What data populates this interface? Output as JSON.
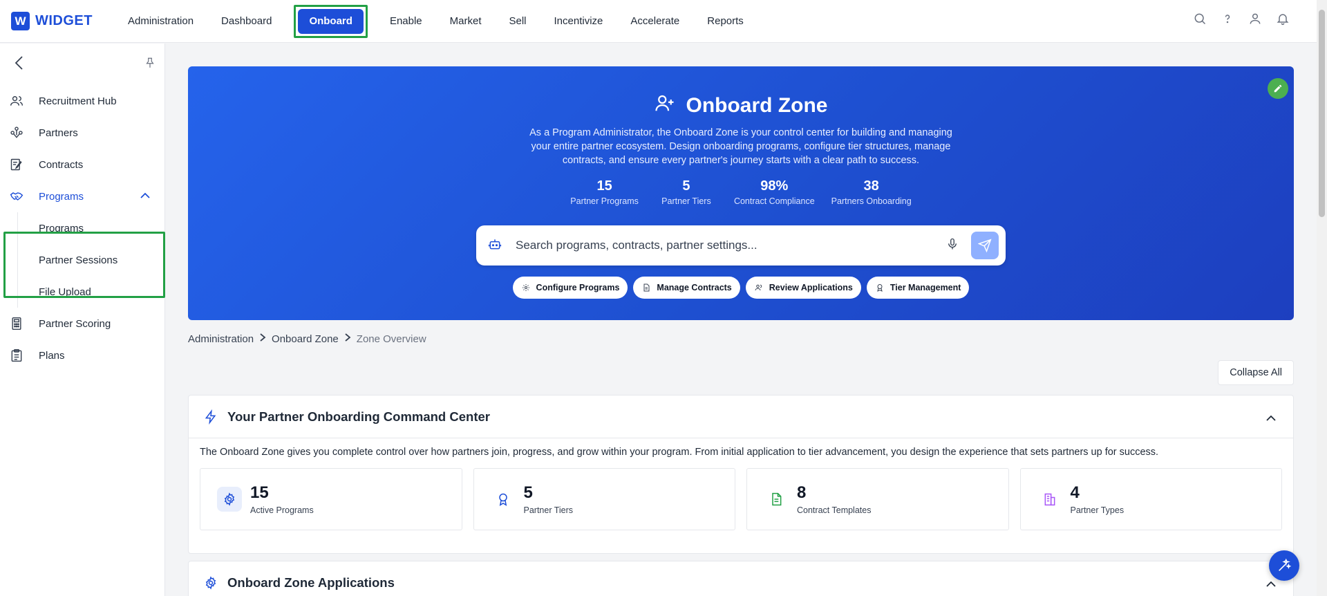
{
  "logo": {
    "mark": "W",
    "text": "WIDGET"
  },
  "nav": {
    "items": [
      {
        "label": "Administration"
      },
      {
        "label": "Dashboard"
      },
      {
        "label": "Onboard"
      },
      {
        "label": "Enable"
      },
      {
        "label": "Market"
      },
      {
        "label": "Sell"
      },
      {
        "label": "Incentivize"
      },
      {
        "label": "Accelerate"
      },
      {
        "label": "Reports"
      }
    ],
    "active": "Onboard",
    "icons": [
      "search-icon",
      "help-icon",
      "user-icon",
      "bell-icon"
    ]
  },
  "sidebar": {
    "items": [
      {
        "label": "Recruitment Hub",
        "icon": "users-icon"
      },
      {
        "label": "Partners",
        "icon": "partners-icon"
      },
      {
        "label": "Contracts",
        "icon": "contract-icon"
      },
      {
        "label": "Programs",
        "icon": "handshake-icon"
      },
      {
        "label": "Partner Scoring",
        "icon": "calculator-icon"
      },
      {
        "label": "Plans",
        "icon": "clipboard-icon"
      }
    ],
    "programs_sub": [
      {
        "label": "Programs"
      },
      {
        "label": "Partner Sessions"
      },
      {
        "label": "File Upload"
      }
    ]
  },
  "hero": {
    "title": "Onboard Zone",
    "description": "As a Program Administrator, the Onboard Zone is your control center for building and managing your entire partner ecosystem. Design onboarding programs, configure tier structures, manage contracts, and ensure every partner's journey starts with a clear path to success.",
    "stats": [
      {
        "value": "15",
        "label": "Partner Programs"
      },
      {
        "value": "5",
        "label": "Partner Tiers"
      },
      {
        "value": "98%",
        "label": "Contract Compliance"
      },
      {
        "value": "38",
        "label": "Partners Onboarding"
      }
    ],
    "search_placeholder": "Search programs, contracts, partner settings...",
    "chips": [
      {
        "label": "Configure Programs",
        "icon": "gear-icon"
      },
      {
        "label": "Manage Contracts",
        "icon": "document-icon"
      },
      {
        "label": "Review Applications",
        "icon": "users-icon"
      },
      {
        "label": "Tier Management",
        "icon": "award-icon"
      }
    ]
  },
  "breadcrumb": [
    "Administration",
    "Onboard Zone",
    "Zone Overview"
  ],
  "collapse_label": "Collapse All",
  "command_center": {
    "title": "Your Partner Onboarding Command Center",
    "description": "The Onboard Zone gives you complete control over how partners join, progress, and grow within your program. From initial application to tier advancement, you design the experience that sets partners up for success.",
    "metrics": [
      {
        "value": "15",
        "label": "Active Programs",
        "color": "#1d4ed8"
      },
      {
        "value": "5",
        "label": "Partner Tiers",
        "color": "#1d4ed8"
      },
      {
        "value": "8",
        "label": "Contract Templates",
        "color": "#22a045"
      },
      {
        "value": "4",
        "label": "Partner Types",
        "color": "#a855f7"
      }
    ]
  },
  "applications": {
    "title": "Onboard Zone Applications"
  },
  "colors": {
    "brand": "#1d4ed8",
    "highlight": "#22a045"
  }
}
